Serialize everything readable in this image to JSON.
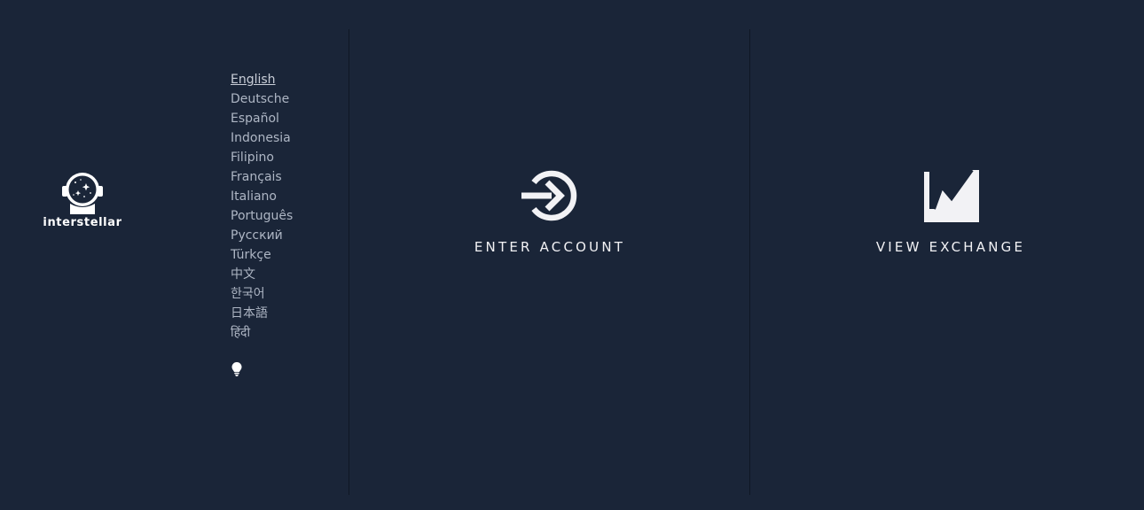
{
  "brand": {
    "name": "interstellar",
    "logo_icon": "astronaut-helmet-icon"
  },
  "languages": {
    "active": "English",
    "items": [
      "English",
      "Deutsche",
      "Español",
      "Indonesia",
      "Filipino",
      "Français",
      "Italiano",
      "Português",
      "Русский",
      "Türkçe",
      "中文",
      "한국어",
      "日本語",
      "हिंदी"
    ]
  },
  "theme_toggle": {
    "icon": "lightbulb-icon"
  },
  "actions": {
    "enter_account": {
      "label": "ENTER ACCOUNT",
      "icon": "sign-in-icon"
    },
    "view_exchange": {
      "label": "VIEW EXCHANGE",
      "icon": "area-chart-icon"
    }
  },
  "colors": {
    "background": "#1a2538",
    "text": "#e8e8ec",
    "muted_text": "#aeb6c4"
  }
}
